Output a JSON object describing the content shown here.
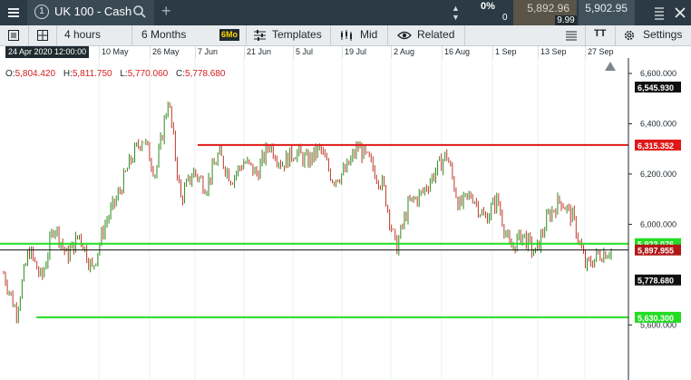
{
  "topbar": {
    "tab_number": "1",
    "instrument": "UK 100 - Cash",
    "change_percent": "0%",
    "change_count": "0",
    "sell_price": "5,892.96",
    "spread": "9.99",
    "buy_price": "5,902.95"
  },
  "toolbar": {
    "interval": "4 hours",
    "period": "6 Months",
    "period_badge": "6Mo",
    "templates": "Templates",
    "price_type": "Mid",
    "related": "Related",
    "settings": "Settings",
    "text_tool": "TT"
  },
  "cursor_date": "24 Apr 2020 12:00:00",
  "ohlc": {
    "o_label": "O:",
    "o": "5,804.420",
    "h_label": "H:",
    "h": "5,811.750",
    "l_label": "L:",
    "l": "5,770.060",
    "c_label": "C:",
    "c": "5,778.680"
  },
  "colors": {
    "up": "#2e8b1e",
    "down": "#c0392b",
    "resistance": "#e01818",
    "support": "#22dd22",
    "current": "#b01818",
    "last": "#101010"
  },
  "chart_data": {
    "type": "line",
    "series": [
      {
        "x": [
          "24 Apr",
          "27 Apr",
          "1 May",
          "5 May",
          "8 May",
          "12 May",
          "14 May",
          "18 May",
          "20 May",
          "24 May",
          "26 May",
          "29 May",
          "1 Jun",
          "4 Jun",
          "7 Jun",
          "9 Jun",
          "11 Jun",
          "14 Jun",
          "16 Jun",
          "20 Jun",
          "22 Jun",
          "25 Jun",
          "29 Jun",
          "3 Jul",
          "6 Jul",
          "9 Jul",
          "13 Jul",
          "16 Jul",
          "20 Jul",
          "23 Jul",
          "27 Jul",
          "31 Jul",
          "3 Aug",
          "6 Aug",
          "10 Aug",
          "13 Aug",
          "17 Aug",
          "20 Aug",
          "24 Aug",
          "27 Aug",
          "31 Aug",
          "3 Sep",
          "7 Sep",
          "10 Sep",
          "14 Sep",
          "17 Sep",
          "21 Sep",
          "24 Sep",
          "28 Sep"
        ],
        "values": [
          5805,
          5650,
          5900,
          5780,
          6000,
          5870,
          5960,
          5820,
          6000,
          6110,
          6250,
          6350,
          6200,
          6500,
          6100,
          6210,
          6150,
          6280,
          6180,
          6250,
          6200,
          6320,
          6240,
          6290,
          6250,
          6300,
          6180,
          6210,
          6310,
          6240,
          6150,
          5900,
          6080,
          6120,
          6200,
          6280,
          6070,
          6120,
          6020,
          6100,
          5900,
          5960,
          5880,
          6030,
          6100,
          6020,
          5830,
          5880,
          5900
        ]
      }
    ],
    "ylim": [
      5500,
      6600
    ],
    "y_ticks": [
      "6,600.000",
      "6,400.000",
      "6,200.000",
      "6,000.000",
      "5,600.000"
    ],
    "x_ticks": [
      "10 May",
      "26 May",
      "7 Jun",
      "21 Jun",
      "5 Jul",
      "19 Jul",
      "2 Aug",
      "16 Aug",
      "1 Sep",
      "13 Sep",
      "27 Sep"
    ],
    "price_tags": {
      "high": "6,545.930",
      "resistance": "6,315.352",
      "upper_support": "5,923.076",
      "current": "5,897.955",
      "last": "5,778.680",
      "lower_support": "5,630.300",
      "hidden_tick": "5,800.000"
    },
    "levels": {
      "resistance": 6315.352,
      "upper_support": 5923.076,
      "current": 5897.955,
      "lower_support": 5630.3
    }
  }
}
